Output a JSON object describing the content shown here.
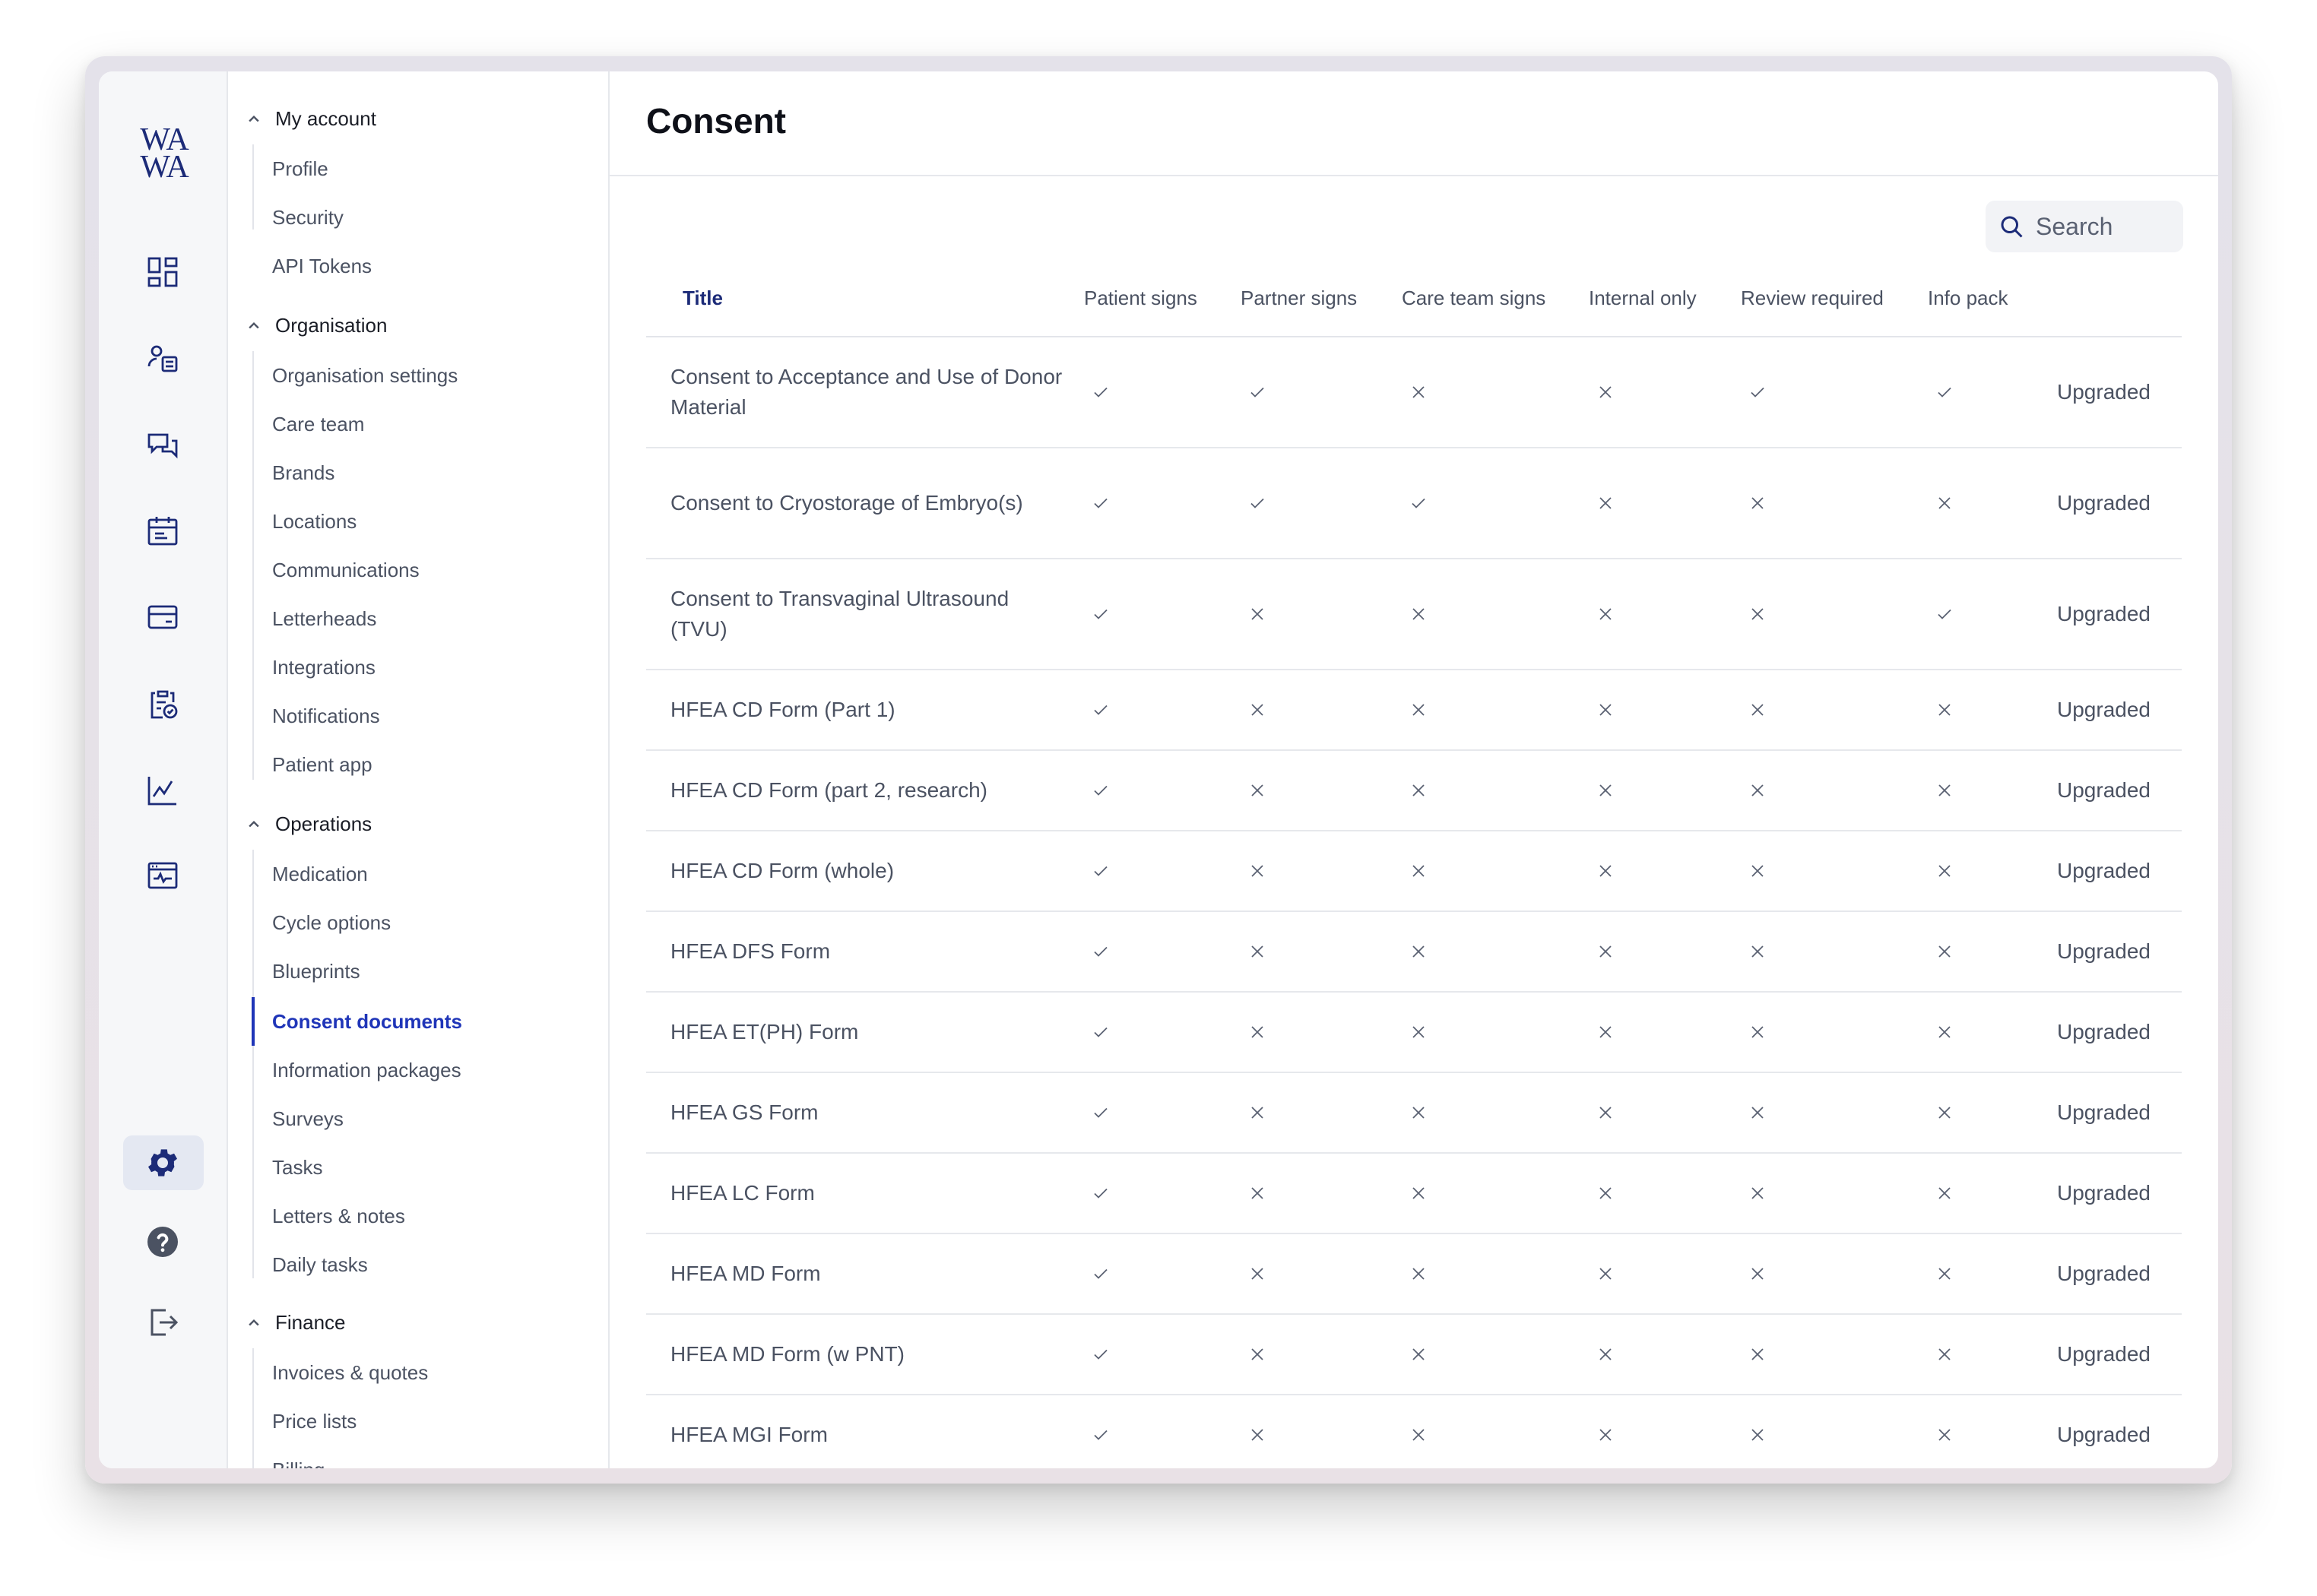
{
  "app": {
    "logo_line1": "WA",
    "logo_line2": "WA",
    "rail_icons": [
      "dashboard-icon",
      "patient-list-icon",
      "messages-icon",
      "calendar-icon",
      "billing-card-icon",
      "clipboard-check-icon",
      "analytics-chart-icon",
      "monitor-icon",
      "settings-gear-icon",
      "help-icon",
      "logout-icon"
    ],
    "active_rail": "settings-gear-icon"
  },
  "sidebar": {
    "sections": [
      {
        "label": "My account",
        "items": [
          "Profile",
          "Security",
          "API Tokens"
        ]
      },
      {
        "label": "Organisation",
        "items": [
          "Organisation settings",
          "Care team",
          "Brands",
          "Locations",
          "Communications",
          "Letterheads",
          "Integrations",
          "Notifications",
          "Patient app"
        ]
      },
      {
        "label": "Operations",
        "items": [
          "Medication",
          "Cycle options",
          "Blueprints",
          "Consent documents",
          "Information packages",
          "Surveys",
          "Tasks",
          "Letters & notes",
          "Daily tasks"
        ]
      },
      {
        "label": "Finance",
        "items": [
          "Invoices & quotes",
          "Price lists",
          "Billing"
        ]
      }
    ],
    "active_item": "Consent documents"
  },
  "main": {
    "title": "Consent",
    "search_label": "Search",
    "columns": [
      "Title",
      "Patient signs",
      "Partner signs",
      "Care team signs",
      "Internal only",
      "Review required",
      "Info pack"
    ],
    "rows": [
      {
        "title": "Consent to Acceptance and Use of Donor Material",
        "marks": [
          "check",
          "check",
          "cross",
          "cross",
          "check",
          "check"
        ],
        "status": "Upgraded"
      },
      {
        "title": "Consent to Cryostorage of Embryo(s)",
        "marks": [
          "check",
          "check",
          "check",
          "cross",
          "cross",
          "cross"
        ],
        "status": "Upgraded"
      },
      {
        "title": "Consent to Transvaginal Ultrasound (TVU)",
        "marks": [
          "check",
          "cross",
          "cross",
          "cross",
          "cross",
          "check"
        ],
        "status": "Upgraded"
      },
      {
        "title": "HFEA CD Form (Part 1)",
        "marks": [
          "check",
          "cross",
          "cross",
          "cross",
          "cross",
          "cross"
        ],
        "status": "Upgraded"
      },
      {
        "title": "HFEA CD Form (part 2, research)",
        "marks": [
          "check",
          "cross",
          "cross",
          "cross",
          "cross",
          "cross"
        ],
        "status": "Upgraded"
      },
      {
        "title": "HFEA CD Form (whole)",
        "marks": [
          "check",
          "cross",
          "cross",
          "cross",
          "cross",
          "cross"
        ],
        "status": "Upgraded"
      },
      {
        "title": "HFEA DFS Form",
        "marks": [
          "check",
          "cross",
          "cross",
          "cross",
          "cross",
          "cross"
        ],
        "status": "Upgraded"
      },
      {
        "title": "HFEA ET(PH) Form",
        "marks": [
          "check",
          "cross",
          "cross",
          "cross",
          "cross",
          "cross"
        ],
        "status": "Upgraded"
      },
      {
        "title": "HFEA GS Form",
        "marks": [
          "check",
          "cross",
          "cross",
          "cross",
          "cross",
          "cross"
        ],
        "status": "Upgraded"
      },
      {
        "title": "HFEA LC Form",
        "marks": [
          "check",
          "cross",
          "cross",
          "cross",
          "cross",
          "cross"
        ],
        "status": "Upgraded"
      },
      {
        "title": "HFEA MD Form",
        "marks": [
          "check",
          "cross",
          "cross",
          "cross",
          "cross",
          "cross"
        ],
        "status": "Upgraded"
      },
      {
        "title": "HFEA MD Form (w PNT)",
        "marks": [
          "check",
          "cross",
          "cross",
          "cross",
          "cross",
          "cross"
        ],
        "status": "Upgraded"
      },
      {
        "title": "HFEA MGI Form",
        "marks": [
          "check",
          "cross",
          "cross",
          "cross",
          "cross",
          "cross"
        ],
        "status": "Upgraded"
      }
    ]
  },
  "colors": {
    "accent": "#1f35b8",
    "brand": "#1c2b78",
    "text_muted": "#4b5262"
  }
}
